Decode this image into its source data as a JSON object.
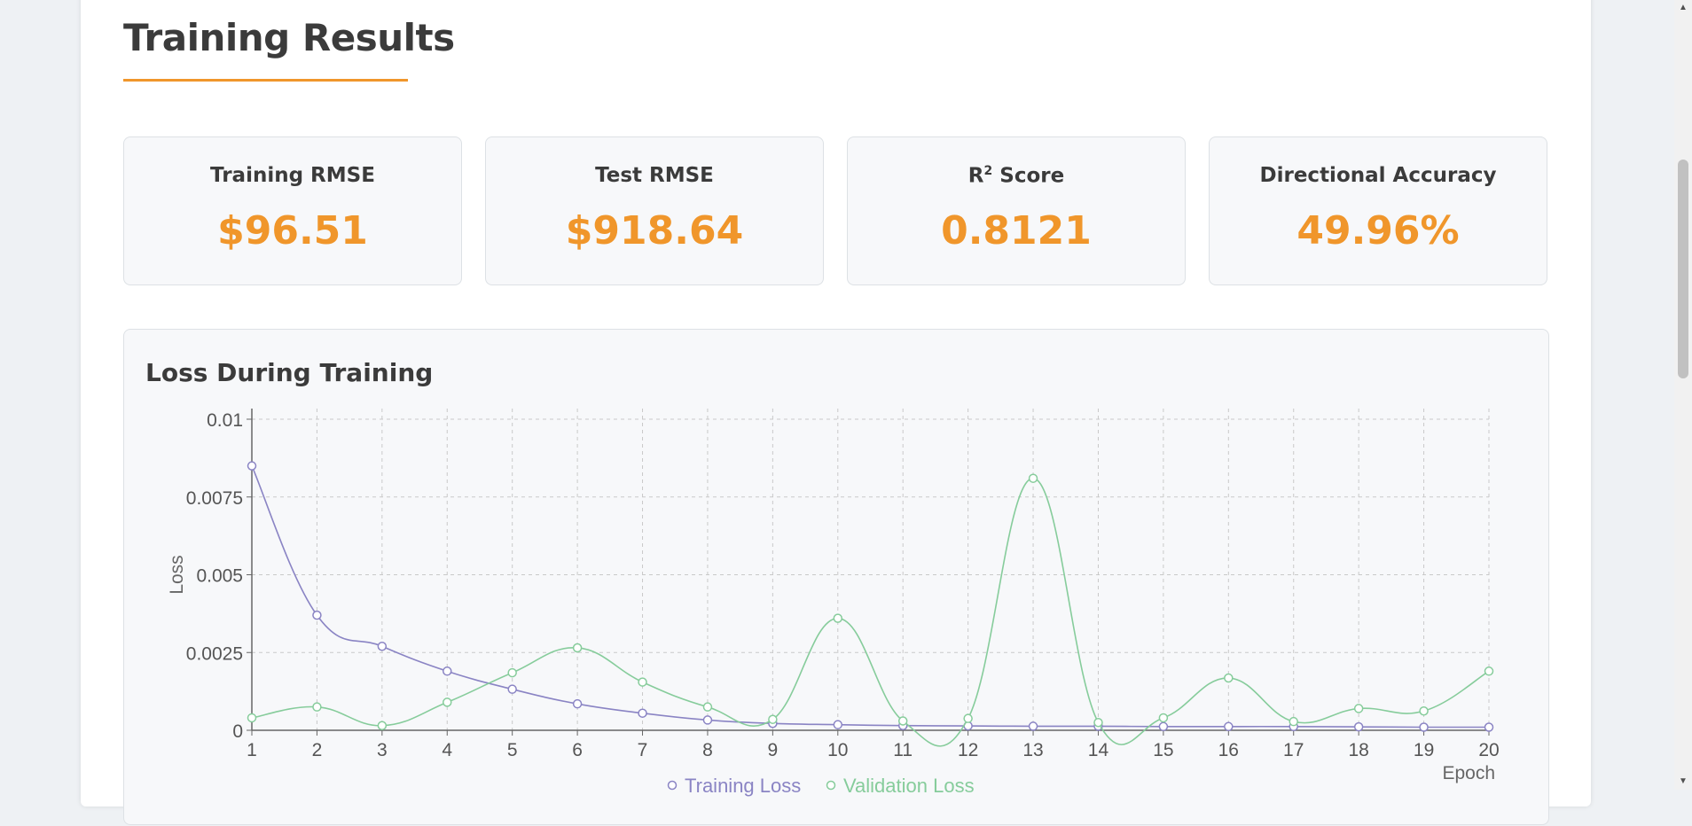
{
  "section": {
    "title": "Training Results"
  },
  "metrics": [
    {
      "label": "Training RMSE",
      "value": "$96.51"
    },
    {
      "label": "Test RMSE",
      "value": "$918.64"
    },
    {
      "label_main": "R",
      "label_sup": "2",
      "label_rest": " Score",
      "value": "0.8121"
    },
    {
      "label": "Directional Accuracy",
      "value": "49.96%"
    }
  ],
  "chart_panel": {
    "title": "Loss During Training"
  },
  "colors": {
    "accent": "#f0962b",
    "training_loss": "#8a84c4",
    "validation_loss": "#86cc9b"
  },
  "chart_data": {
    "type": "line",
    "title": "Loss During Training",
    "xlabel": "Epoch",
    "ylabel": "Loss",
    "x": [
      1,
      2,
      3,
      4,
      5,
      6,
      7,
      8,
      9,
      10,
      11,
      12,
      13,
      14,
      15,
      16,
      17,
      18,
      19,
      20
    ],
    "ylim": [
      0,
      0.01
    ],
    "yticks": [
      "0",
      "0.0025",
      "0.005",
      "0.0075",
      "0.01"
    ],
    "ytick_values": [
      0,
      0.0025,
      0.005,
      0.0075,
      0.01
    ],
    "grid": true,
    "legend": "bottom-center",
    "series": [
      {
        "name": "Training Loss",
        "values": [
          0.0085,
          0.0037,
          0.0027,
          0.0019,
          0.00132,
          0.00085,
          0.00055,
          0.00033,
          0.00022,
          0.00018,
          0.00015,
          0.00014,
          0.00013,
          0.00013,
          0.00012,
          0.00012,
          0.00012,
          0.00011,
          0.0001,
          0.0001
        ]
      },
      {
        "name": "Validation Loss",
        "values": [
          0.0004,
          0.00075,
          0.00015,
          0.0009,
          0.00185,
          0.00265,
          0.00155,
          0.00075,
          0.00035,
          0.0036,
          0.0003,
          0.00038,
          0.0081,
          0.00025,
          0.0004,
          0.00168,
          0.00028,
          0.0007,
          0.00062,
          0.0019
        ]
      }
    ]
  }
}
